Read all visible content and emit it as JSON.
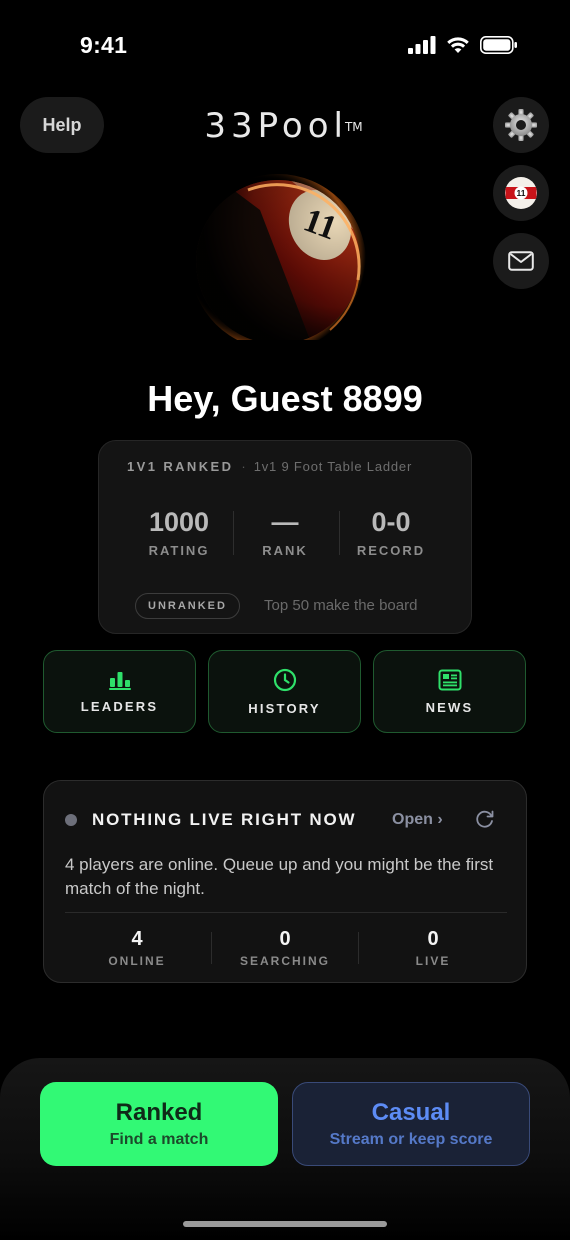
{
  "status_bar": {
    "time": "9:41"
  },
  "header": {
    "help_label": "Help",
    "logo_text": "33Pool",
    "logo_mark": "TM",
    "right_buttons": [
      {
        "name": "settings",
        "icon": "gear-icon"
      },
      {
        "name": "ball-avatar",
        "icon": "pool-ball-11-icon",
        "ball_number": "11"
      },
      {
        "name": "inbox",
        "icon": "mail-icon"
      }
    ]
  },
  "hero": {
    "ball_number": "11",
    "icon": "pool-ball-11-icon",
    "colors": {
      "stripe": "#8c1208",
      "glow": "#ff7a1a",
      "number_band": "#e9d7b6"
    }
  },
  "greeting": "Hey, Guest 8899",
  "ranked_card": {
    "ladder_title": "1V1 RANKED",
    "separator": "·",
    "ladder_subtitle": "1v1 9 Foot Table Ladder",
    "stats": [
      {
        "value": "1000",
        "label": "RATING"
      },
      {
        "value": "—",
        "label": "RANK"
      },
      {
        "value": "0-0",
        "label": "RECORD"
      }
    ],
    "badge": "UNRANKED",
    "note": "Top 50 make the board"
  },
  "nav": [
    {
      "label": "LEADERS",
      "icon": "bar-chart-icon"
    },
    {
      "label": "HISTORY",
      "icon": "clock-icon"
    },
    {
      "label": "NEWS",
      "icon": "newspaper-icon"
    }
  ],
  "live": {
    "title": "NOTHING LIVE RIGHT NOW",
    "open_label": "Open ›",
    "description": "4 players are online. Queue up and you might be the first match of the night.",
    "stats": [
      {
        "value": "4",
        "label": "ONLINE"
      },
      {
        "value": "0",
        "label": "SEARCHING"
      },
      {
        "value": "0",
        "label": "LIVE"
      }
    ]
  },
  "actions": {
    "ranked": {
      "title": "Ranked",
      "subtitle": "Find a match"
    },
    "casual": {
      "title": "Casual",
      "subtitle": "Stream or keep score"
    }
  },
  "colors": {
    "accent_green": "#32f975",
    "nav_border": "#1f5a2f",
    "casual_blue": "#5d8cf5",
    "background": "#000000"
  }
}
